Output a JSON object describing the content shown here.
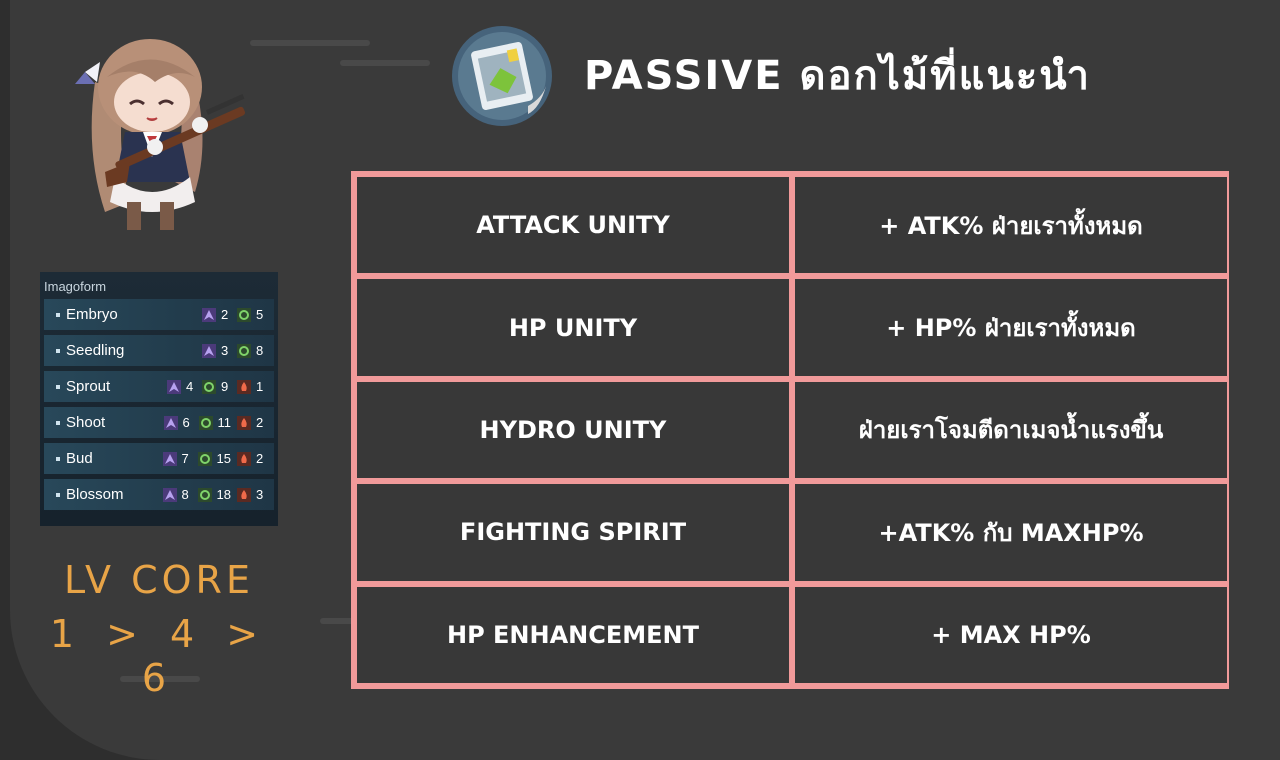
{
  "header": {
    "title": "PASSIVE ดอกไม้ที่แนะนำ",
    "icon": "sticker-icon"
  },
  "imagoform": {
    "title": "Imagoform",
    "rows": [
      {
        "name": "Embryo",
        "stats": [
          {
            "icon": "purple-triangle-icon",
            "value": "2"
          },
          {
            "icon": "green-orb-icon",
            "value": "5"
          }
        ]
      },
      {
        "name": "Seedling",
        "stats": [
          {
            "icon": "purple-triangle-icon",
            "value": "3"
          },
          {
            "icon": "green-orb-icon",
            "value": "8"
          }
        ]
      },
      {
        "name": "Sprout",
        "stats": [
          {
            "icon": "purple-triangle-icon",
            "value": "4"
          },
          {
            "icon": "green-orb-icon",
            "value": "9"
          },
          {
            "icon": "red-flame-icon",
            "value": "1"
          }
        ]
      },
      {
        "name": "Shoot",
        "stats": [
          {
            "icon": "purple-triangle-icon",
            "value": "6"
          },
          {
            "icon": "green-orb-icon",
            "value": "11"
          },
          {
            "icon": "red-flame-icon",
            "value": "2"
          }
        ]
      },
      {
        "name": "Bud",
        "stats": [
          {
            "icon": "purple-triangle-icon",
            "value": "7"
          },
          {
            "icon": "green-orb-icon",
            "value": "15"
          },
          {
            "icon": "red-flame-icon",
            "value": "2"
          }
        ]
      },
      {
        "name": "Blossom",
        "stats": [
          {
            "icon": "purple-triangle-icon",
            "value": "8"
          },
          {
            "icon": "green-orb-icon",
            "value": "18"
          },
          {
            "icon": "red-flame-icon",
            "value": "3"
          }
        ]
      }
    ]
  },
  "lv_core": {
    "label": "LV CORE",
    "sequence": "1 > 4 > 6"
  },
  "passives": [
    {
      "name": "ATTACK UNITY",
      "effect": "+ ATK% ฝ่ายเราทั้งหมด"
    },
    {
      "name": "HP UNITY",
      "effect": "+ HP% ฝ่ายเราทั้งหมด"
    },
    {
      "name": "HYDRO UNITY",
      "effect": "ฝ่ายเราโจมตีดาเมจน้ำแรงขึ้น"
    },
    {
      "name": "FIGHTING SPIRIT",
      "effect": "+ATK% กับ MAXHP%"
    },
    {
      "name": "HP ENHANCEMENT",
      "effect": "+ MAX HP%"
    }
  ],
  "colors": {
    "accent_orange": "#e8a447",
    "table_border": "#f19a9a",
    "cell_bg": "#383838",
    "panel_bg": "#3a3a3a"
  }
}
